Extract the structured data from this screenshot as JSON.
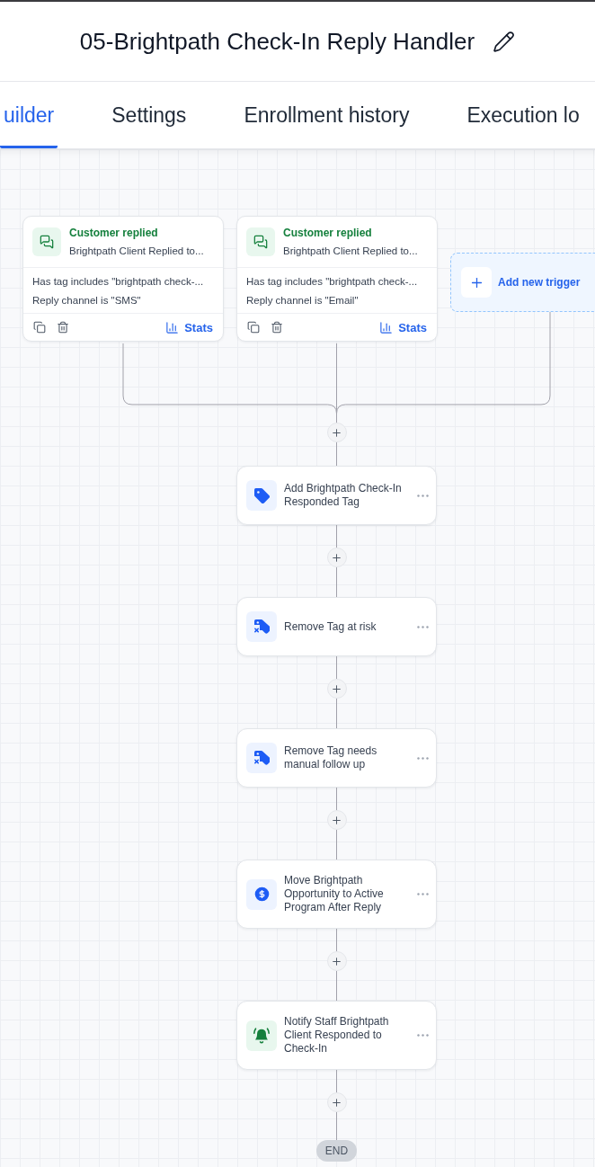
{
  "workflow": {
    "title": "05-Brightpath Check-In Reply Handler"
  },
  "tabs": [
    {
      "label": "uilder",
      "selected": true
    },
    {
      "label": "Settings",
      "selected": false
    },
    {
      "label": "Enrollment history",
      "selected": false
    },
    {
      "label": "Execution lo",
      "selected": false
    }
  ],
  "triggers": [
    {
      "title": "Customer replied",
      "subtitle": "Brightpath Client Replied to...",
      "conditions": [
        "Has tag includes \"brightpath check-...",
        "Reply channel is \"SMS\""
      ],
      "stats_label": "Stats"
    },
    {
      "title": "Customer replied",
      "subtitle": "Brightpath Client Replied to...",
      "conditions": [
        "Has tag includes \"brightpath check-...",
        "Reply channel is \"Email\""
      ],
      "stats_label": "Stats"
    }
  ],
  "add_trigger": {
    "label": "Add new trigger"
  },
  "actions": [
    {
      "kind": "add_tag",
      "label": "Add Brightpath Check-In Responded Tag"
    },
    {
      "kind": "remove_tag",
      "label": "Remove Tag at risk"
    },
    {
      "kind": "remove_tag",
      "label": "Remove Tag needs manual follow up"
    },
    {
      "kind": "opportunity",
      "label": "Move Brightpath Opportunity to Active Program After Reply"
    },
    {
      "kind": "notify",
      "label": "Notify Staff Brightpath Client Responded to Check-In"
    }
  ],
  "end_label": "END"
}
